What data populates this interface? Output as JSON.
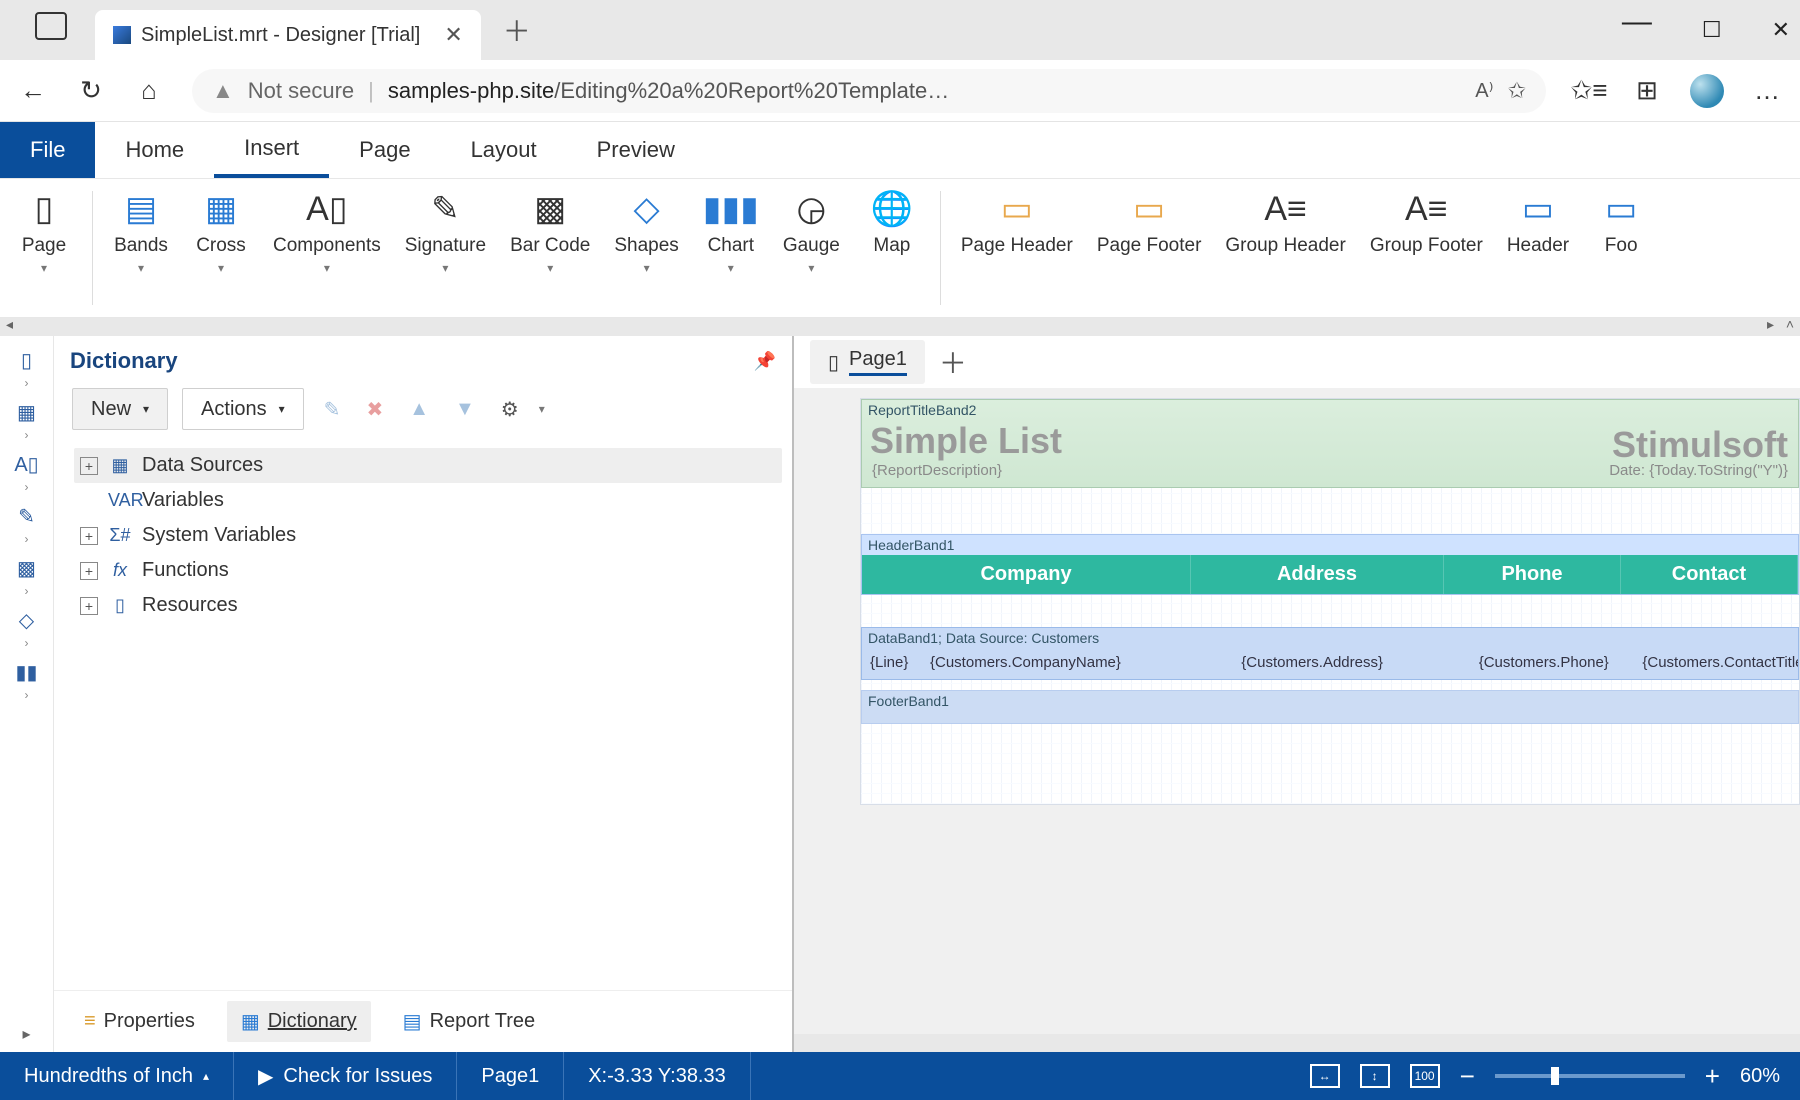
{
  "window": {
    "title": "SimpleList.mrt - Designer [Trial]"
  },
  "browser": {
    "security_label": "Not secure",
    "url_host": "samples-php.site",
    "url_path": "/Editing%20a%20Report%20Template…"
  },
  "menu": {
    "file": "File",
    "home": "Home",
    "insert": "Insert",
    "page": "Page",
    "layout": "Layout",
    "preview": "Preview"
  },
  "ribbon": {
    "page": "Page",
    "bands": "Bands",
    "cross": "Cross",
    "components": "Components",
    "signature": "Signature",
    "barcode": "Bar Code",
    "shapes": "Shapes",
    "chart": "Chart",
    "gauge": "Gauge",
    "map": "Map",
    "pageheader": "Page Header",
    "pagefooter": "Page Footer",
    "groupheader": "Group Header",
    "groupfooter": "Group Footer",
    "header": "Header",
    "footer": "Foo"
  },
  "dictionary": {
    "title": "Dictionary",
    "btn_new": "New",
    "btn_actions": "Actions",
    "nodes": {
      "datasources": "Data Sources",
      "variables": "Variables",
      "sysvars": "System Variables",
      "functions": "Functions",
      "resources": "Resources"
    },
    "tabs": {
      "properties": "Properties",
      "dictionary": "Dictionary",
      "reporttree": "Report Tree"
    }
  },
  "pagetabs": {
    "page1": "Page1"
  },
  "design": {
    "report_title_band": "ReportTitleBand2",
    "report_title": "Simple List",
    "brand": "Stimulsoft",
    "report_desc": "{ReportDescription}",
    "report_date": "Date: {Today.ToString(\"Y\")}",
    "header_band": "HeaderBand1",
    "cols": {
      "company": "Company",
      "address": "Address",
      "phone": "Phone",
      "contact": "Contact"
    },
    "data_band": "DataBand1; Data Source: Customers",
    "cells": {
      "line": "{Line}",
      "company": "{Customers.CompanyName}",
      "address": "{Customers.Address}",
      "phone": "{Customers.Phone}",
      "contact": "{Customers.ContactTitle}"
    },
    "footer_band": "FooterBand1"
  },
  "status": {
    "units": "Hundredths of Inch",
    "check": "Check for Issues",
    "page": "Page1",
    "coords": "X:-3.33 Y:38.33",
    "hundred": "100",
    "zoom": "60%"
  }
}
